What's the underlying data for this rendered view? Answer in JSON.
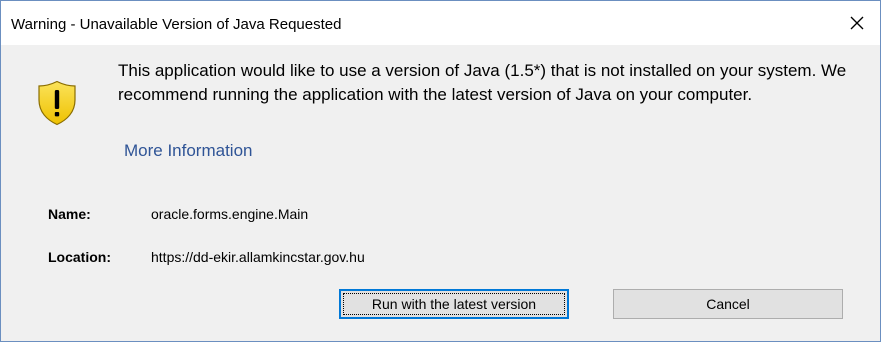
{
  "window": {
    "title": "Warning - Unavailable Version of Java Requested"
  },
  "icons": {
    "close": "close-icon",
    "warning": "warning-shield-icon"
  },
  "message": {
    "text": "This application would like to use a version of Java (1.5*) that is not installed on your system. We recommend running the application with the latest version of Java on your computer.",
    "more_info_link": "More Information"
  },
  "details": {
    "name_label": "Name:",
    "name_value": "oracle.forms.engine.Main",
    "location_label": "Location:",
    "location_value": "https://dd-ekir.allamkincstar.gov.hu"
  },
  "buttons": {
    "run_latest": "Run with the latest version",
    "cancel": "Cancel"
  },
  "colors": {
    "link": "#2f5496",
    "window_border": "#6b8fc0",
    "default_button_border": "#0078d7",
    "shield_yellow": "#f5d000"
  }
}
